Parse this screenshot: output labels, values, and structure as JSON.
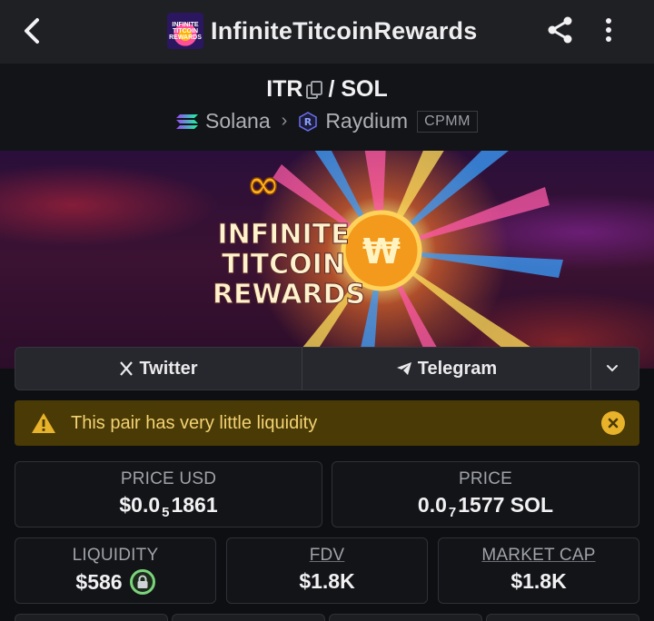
{
  "header": {
    "title": "InfiniteTitcoinRewards",
    "logo_text": "INFINITE TITCOIN REWARDS",
    "icons": {
      "back": "back-arrow-icon",
      "share": "share-icon",
      "more": "more-vertical-icon"
    }
  },
  "pair": {
    "base": "ITR",
    "quote": "/ SOL",
    "chain": "Solana",
    "dex": "Raydium",
    "pool_type": "CPMM"
  },
  "banner": {
    "line1": "INFINITE",
    "line2": "TITCOIN",
    "line3": "REWARDS"
  },
  "social": {
    "twitter": "Twitter",
    "telegram": "Telegram"
  },
  "warning": {
    "text": "This pair has very little liquidity"
  },
  "stats": {
    "price_usd": {
      "label": "PRICE USD",
      "prefix": "$0.0",
      "sub": "5",
      "suffix": "1861"
    },
    "price": {
      "label": "PRICE",
      "prefix": "0.0",
      "sub": "7",
      "suffix": "1577 SOL"
    },
    "liquidity": {
      "label": "LIQUIDITY",
      "value": "$586"
    },
    "fdv": {
      "label": "FDV",
      "value": "$1.8K"
    },
    "market_cap": {
      "label": "MARKET CAP",
      "value": "$1.8K"
    }
  },
  "colors": {
    "accent_warning": "#e8b22a",
    "warning_bg": "#4a3a06",
    "lock_green": "#7bd37b"
  }
}
